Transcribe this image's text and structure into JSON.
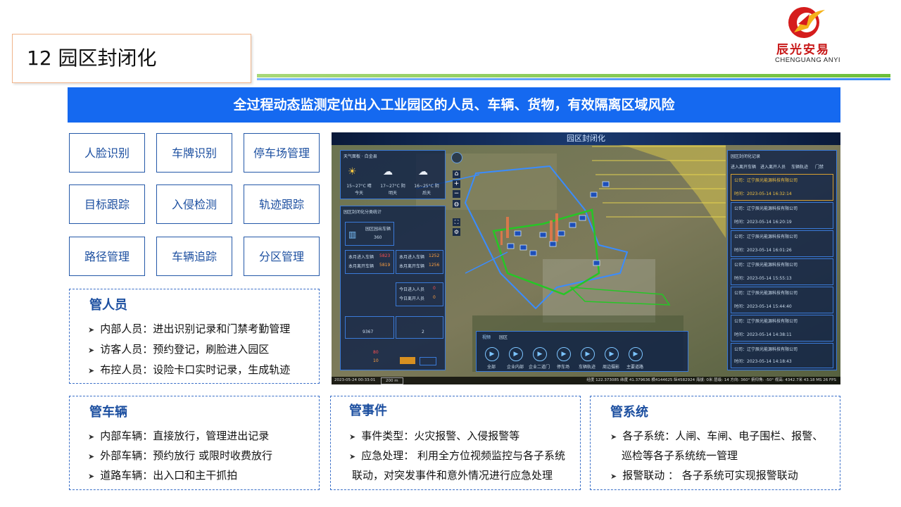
{
  "slide": {
    "title": "12 园区封闭化",
    "banner": "全过程动态监测定位出入工业园区的人员、车辆、货物，有效隔离区域风险"
  },
  "logo": {
    "name_cn": "辰光安易",
    "name_en": "CHENGUANG ANYI",
    "brand_red": "#c81818"
  },
  "features": [
    "人脸识别",
    "车牌识别",
    "停车场管理",
    "目标跟踪",
    "入侵检测",
    "轨迹跟踪",
    "路径管理",
    "车辆追踪",
    "分区管理"
  ],
  "people": {
    "title": "管人员",
    "items": [
      "内部人员：进出识别记录和门禁考勤管理",
      "访客人员：预约登记，刷脸进入园区",
      "布控人员：设险卡口实时记录，生成轨迹"
    ]
  },
  "vehicles": {
    "title": "管车辆",
    "items": [
      "内部车辆：直接放行，管理进出记录",
      "外部车辆：预约放行 或限时收费放行",
      "道路车辆：出入口和主干抓拍"
    ]
  },
  "events": {
    "title": "管事件",
    "items": [
      "事件类型：火灾报警、入侵报警等",
      "应急处理： 利用全方位视频监控与各子系统",
      "联动，对突发事件和意外情况进行应急处理"
    ]
  },
  "systems": {
    "title": "管系统",
    "items": [
      "各子系统：人闸、车闸、电子围栏、报警、",
      "巡检等各子系统统一管理",
      "报警联动 ： 各子系统可实现报警联动"
    ]
  },
  "screenshot": {
    "title": "园区封闭化",
    "weather_title": "天气面板 · 白金县",
    "weather": [
      {
        "icon": "sun-icon",
        "temp": "15~27°C 晴",
        "day": "今天"
      },
      {
        "icon": "cloud-icon",
        "temp": "17~27°C 阴",
        "day": "明天"
      },
      {
        "icon": "cloud-icon",
        "temp": "16~25°C 阴",
        "day": "后天"
      }
    ],
    "stats_title": "园区封闭化分类统计",
    "stats_rows": [
      {
        "label": "园区园出车辆",
        "value": "360"
      },
      {
        "label": "本月进入车辆",
        "value": "5823"
      },
      {
        "label": "本月离开车辆",
        "value": "5819"
      },
      {
        "label": "本月进入车辆",
        "value": "1252"
      },
      {
        "label": "本月离开车辆",
        "value": "1256"
      },
      {
        "label": "今日进入人员",
        "value": "0"
      },
      {
        "label": "今日离开人员",
        "value": "0"
      }
    ],
    "track_count": "9367",
    "track_count2": "2",
    "monitor_online": "80",
    "monitor_offline": "10",
    "right_title": "园区封闭化记录",
    "right_tabs": [
      "进入离开车辆",
      "进入离开人员",
      "车辆轨迹",
      "门禁"
    ],
    "records": [
      {
        "company": "公司：辽宁辰光能源科技有限公司",
        "detail": "时间：2023-05-14 16:32:14"
      },
      {
        "company": "公司：辽宁辰光能源科技有限公司",
        "detail": "时间：2023-05-14 16:20:19"
      },
      {
        "company": "公司：辽宁辰光能源科技有限公司",
        "detail": "时间：2023-05-14 16:01:26"
      },
      {
        "company": "公司：辽宁辰光能源科技有限公司",
        "detail": "时间：2023-05-14 15:55:13"
      },
      {
        "company": "公司：辽宁辰光能源科技有限公司",
        "detail": "时间：2023-05-14 15:44:40"
      },
      {
        "company": "公司：辽宁辰光能源科技有限公司",
        "detail": "时间：2023-05-14 14:38:11"
      },
      {
        "company": "公司：辽宁辰光能源科技有限公司",
        "detail": "时间：2023-05-14 14:18:43"
      }
    ],
    "bottom_tabs": [
      "视频",
      "园区"
    ],
    "bottom_items": [
      "全部",
      "企业内部",
      "企业二道门",
      "停车场",
      "车辆轨迹",
      "周边摄影",
      "主要道路"
    ],
    "status_left": "2023-05-24 00:33:01",
    "scale": "200 m",
    "status_right": "经度 122.373085   纬度 41.379636   横4144625 纵4582924   海拔: 0米   层级: 14   方向: 360°   俯仰角: -50°   视高: 4342.7米   43.18 MS   26 FPS"
  }
}
